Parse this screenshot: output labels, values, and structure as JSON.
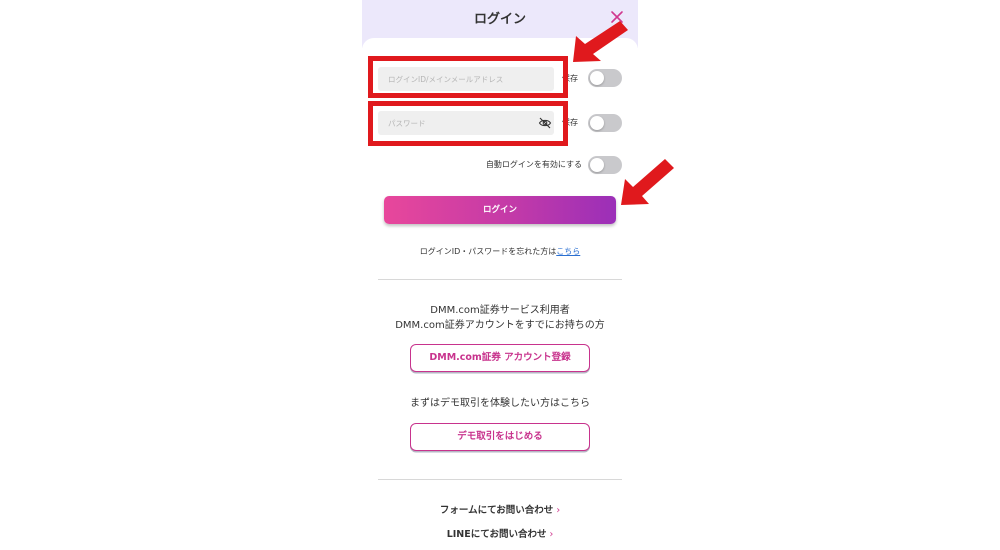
{
  "header": {
    "title": "ログイン"
  },
  "login_id": {
    "placeholder": "ログインID/メインメールアドレス",
    "save_label": "保存"
  },
  "password": {
    "placeholder": "パスワード",
    "save_label": "保存"
  },
  "auto_login": {
    "label": "自動ログインを有効にする"
  },
  "login_button": {
    "label": "ログイン"
  },
  "forgot": {
    "text": "ログインID・パスワードを忘れた方は",
    "link": "こちら"
  },
  "existing_users": {
    "line1": "DMM.com証券サービス利用者",
    "line2": "DMM.com証券アカウントをすでにお持ちの方",
    "button": "DMM.com証券 アカウント登録"
  },
  "demo": {
    "text": "まずはデモ取引を体験したい方はこちら",
    "button": "デモ取引をはじめる"
  },
  "contact": {
    "form": "フォームにてお問い合わせ",
    "line": "LINEにてお問い合わせ"
  },
  "icons": {
    "close": "close-icon",
    "eye": "eye-slash-icon",
    "chevron": "chevron-right-icon",
    "annotation_arrow": "red-arrow-icon"
  },
  "colors": {
    "header_bg": "#ece8fb",
    "accent": "#c8338d",
    "annotation": "#e0191d",
    "link": "#2a6fd1"
  },
  "toggles": {
    "login_id_save": false,
    "password_save": false,
    "auto_login": false
  }
}
